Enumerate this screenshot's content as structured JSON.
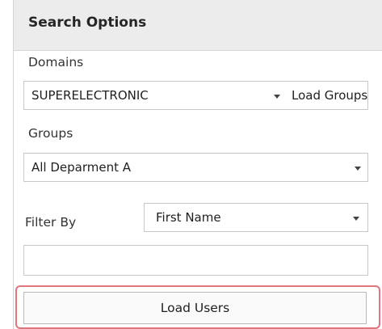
{
  "search_options": {
    "title": "Search Options",
    "domains": {
      "label": "Domains",
      "selected": "SUPERELECTRONIC",
      "load_groups_label": "Load Groups"
    },
    "groups": {
      "label": "Groups",
      "selected": "All Deparment A"
    },
    "filter": {
      "label": "Filter By",
      "selected": "First Name",
      "text_value": ""
    },
    "load_users_label": "Load Users"
  }
}
